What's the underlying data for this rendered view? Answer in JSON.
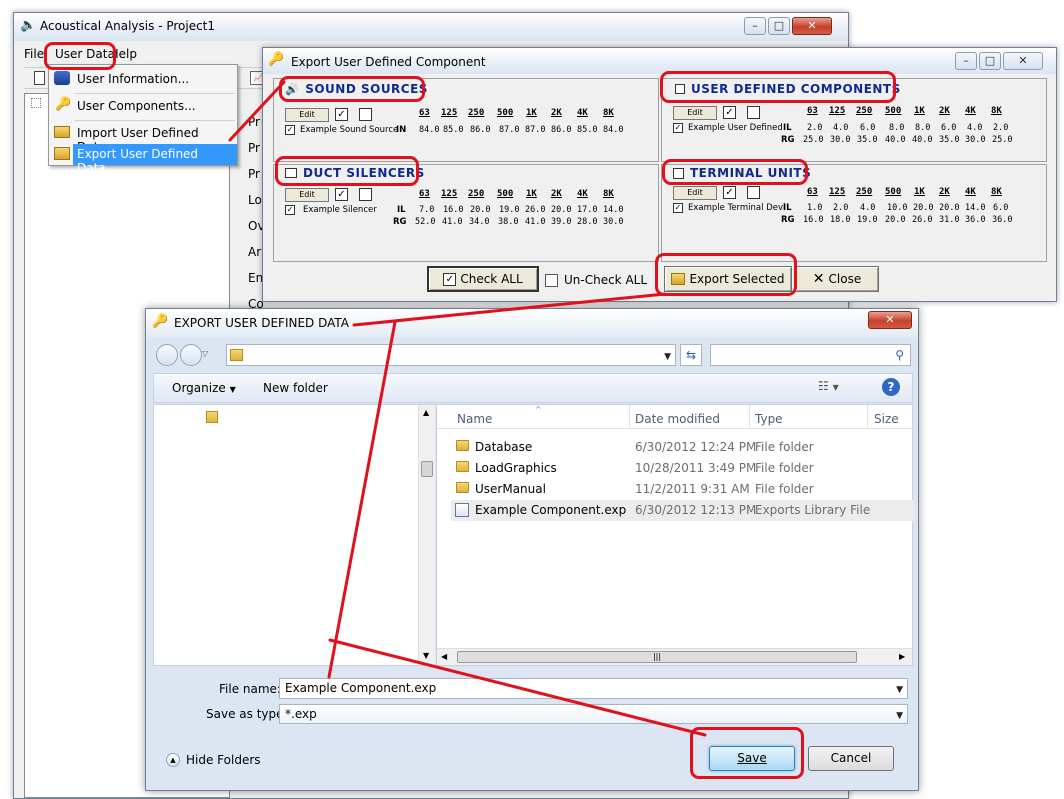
{
  "main_window": {
    "title": "Acoustical Analysis - Project1",
    "menu": [
      "File",
      "User Data",
      "Help"
    ],
    "menu_items": [
      {
        "label": "User Information...",
        "icon": "users-icon"
      },
      {
        "label": "User Components...",
        "icon": "key-icon"
      },
      {
        "label": "Import User Defined Data...",
        "icon": "import-icon"
      },
      {
        "label": "Export User Defined Data...",
        "icon": "export-icon",
        "selected": true
      }
    ],
    "background_labels": [
      "Pr",
      "Pr",
      "Pr",
      "Lo",
      "Ov",
      "Ar",
      "En",
      "Co"
    ]
  },
  "export_dialog": {
    "title": "Export User Defined Component",
    "octave_bands": [
      "63",
      "125",
      "250",
      "500",
      "1K",
      "2K",
      "4K",
      "8K"
    ],
    "edit_label": "Edit",
    "sections": {
      "sound_sources": {
        "title": "SOUND SOURCES",
        "item_label": "Example Sound Source",
        "rows": [
          {
            "label": "IN",
            "values": [
              "84.0",
              "85.0",
              "86.0",
              "87.0",
              "87.0",
              "86.0",
              "85.0",
              "84.0"
            ]
          }
        ]
      },
      "user_defined_components": {
        "title": "USER DEFINED COMPONENTS",
        "item_label": "Example User Defined",
        "rows": [
          {
            "label": "IL",
            "values": [
              "2.0",
              "4.0",
              "6.0",
              "8.0",
              "8.0",
              "6.0",
              "4.0",
              "2.0"
            ]
          },
          {
            "label": "RG",
            "values": [
              "25.0",
              "30.0",
              "35.0",
              "40.0",
              "40.0",
              "35.0",
              "30.0",
              "25.0"
            ]
          }
        ]
      },
      "duct_silencers": {
        "title": "DUCT SILENCERS",
        "item_label": "Example Silencer",
        "rows": [
          {
            "label": "IL",
            "values": [
              "7.0",
              "16.0",
              "20.0",
              "19.0",
              "26.0",
              "20.0",
              "17.0",
              "14.0"
            ]
          },
          {
            "label": "RG",
            "values": [
              "52.0",
              "41.0",
              "34.0",
              "38.0",
              "41.0",
              "39.0",
              "28.0",
              "30.0"
            ]
          }
        ]
      },
      "terminal_units": {
        "title": "TERMINAL UNITS",
        "item_label": "Example Terminal Devi",
        "rows": [
          {
            "label": "IL",
            "values": [
              "1.0",
              "2.0",
              "4.0",
              "10.0",
              "20.0",
              "20.0",
              "14.0",
              "6.0"
            ]
          },
          {
            "label": "RG",
            "values": [
              "16.0",
              "18.0",
              "19.0",
              "20.0",
              "26.0",
              "31.0",
              "36.0",
              "36.0"
            ]
          }
        ]
      }
    },
    "buttons": {
      "check_all": "Check ALL",
      "uncheck_all": "Un-Check ALL",
      "export_selected": "Export Selected",
      "close": "Close"
    }
  },
  "save_dialog": {
    "title": "EXPORT USER DEFINED DATA",
    "toolbar": {
      "organize": "Organize",
      "new_folder": "New folder"
    },
    "columns": [
      "Name",
      "Date modified",
      "Type",
      "Size"
    ],
    "files": [
      {
        "name": "Database",
        "date": "6/30/2012 12:24 PM",
        "type": "File folder",
        "icon": "folder-icon"
      },
      {
        "name": "LoadGraphics",
        "date": "10/28/2011 3:49 PM",
        "type": "File folder",
        "icon": "folder-icon"
      },
      {
        "name": "UserManual",
        "date": "11/2/2011 9:31 AM",
        "type": "File folder",
        "icon": "folder-icon"
      },
      {
        "name": "Example Component.exp",
        "date": "6/30/2012 12:13 PM",
        "type": "Exports Library File",
        "icon": "exp-file-icon"
      }
    ],
    "file_name_label": "File name:",
    "file_name_value": "Example Component.exp",
    "save_type_label": "Save as type:",
    "save_type_value": "*.exp",
    "hide_folders": "Hide Folders",
    "save_button": "Save",
    "cancel_button": "Cancel"
  }
}
